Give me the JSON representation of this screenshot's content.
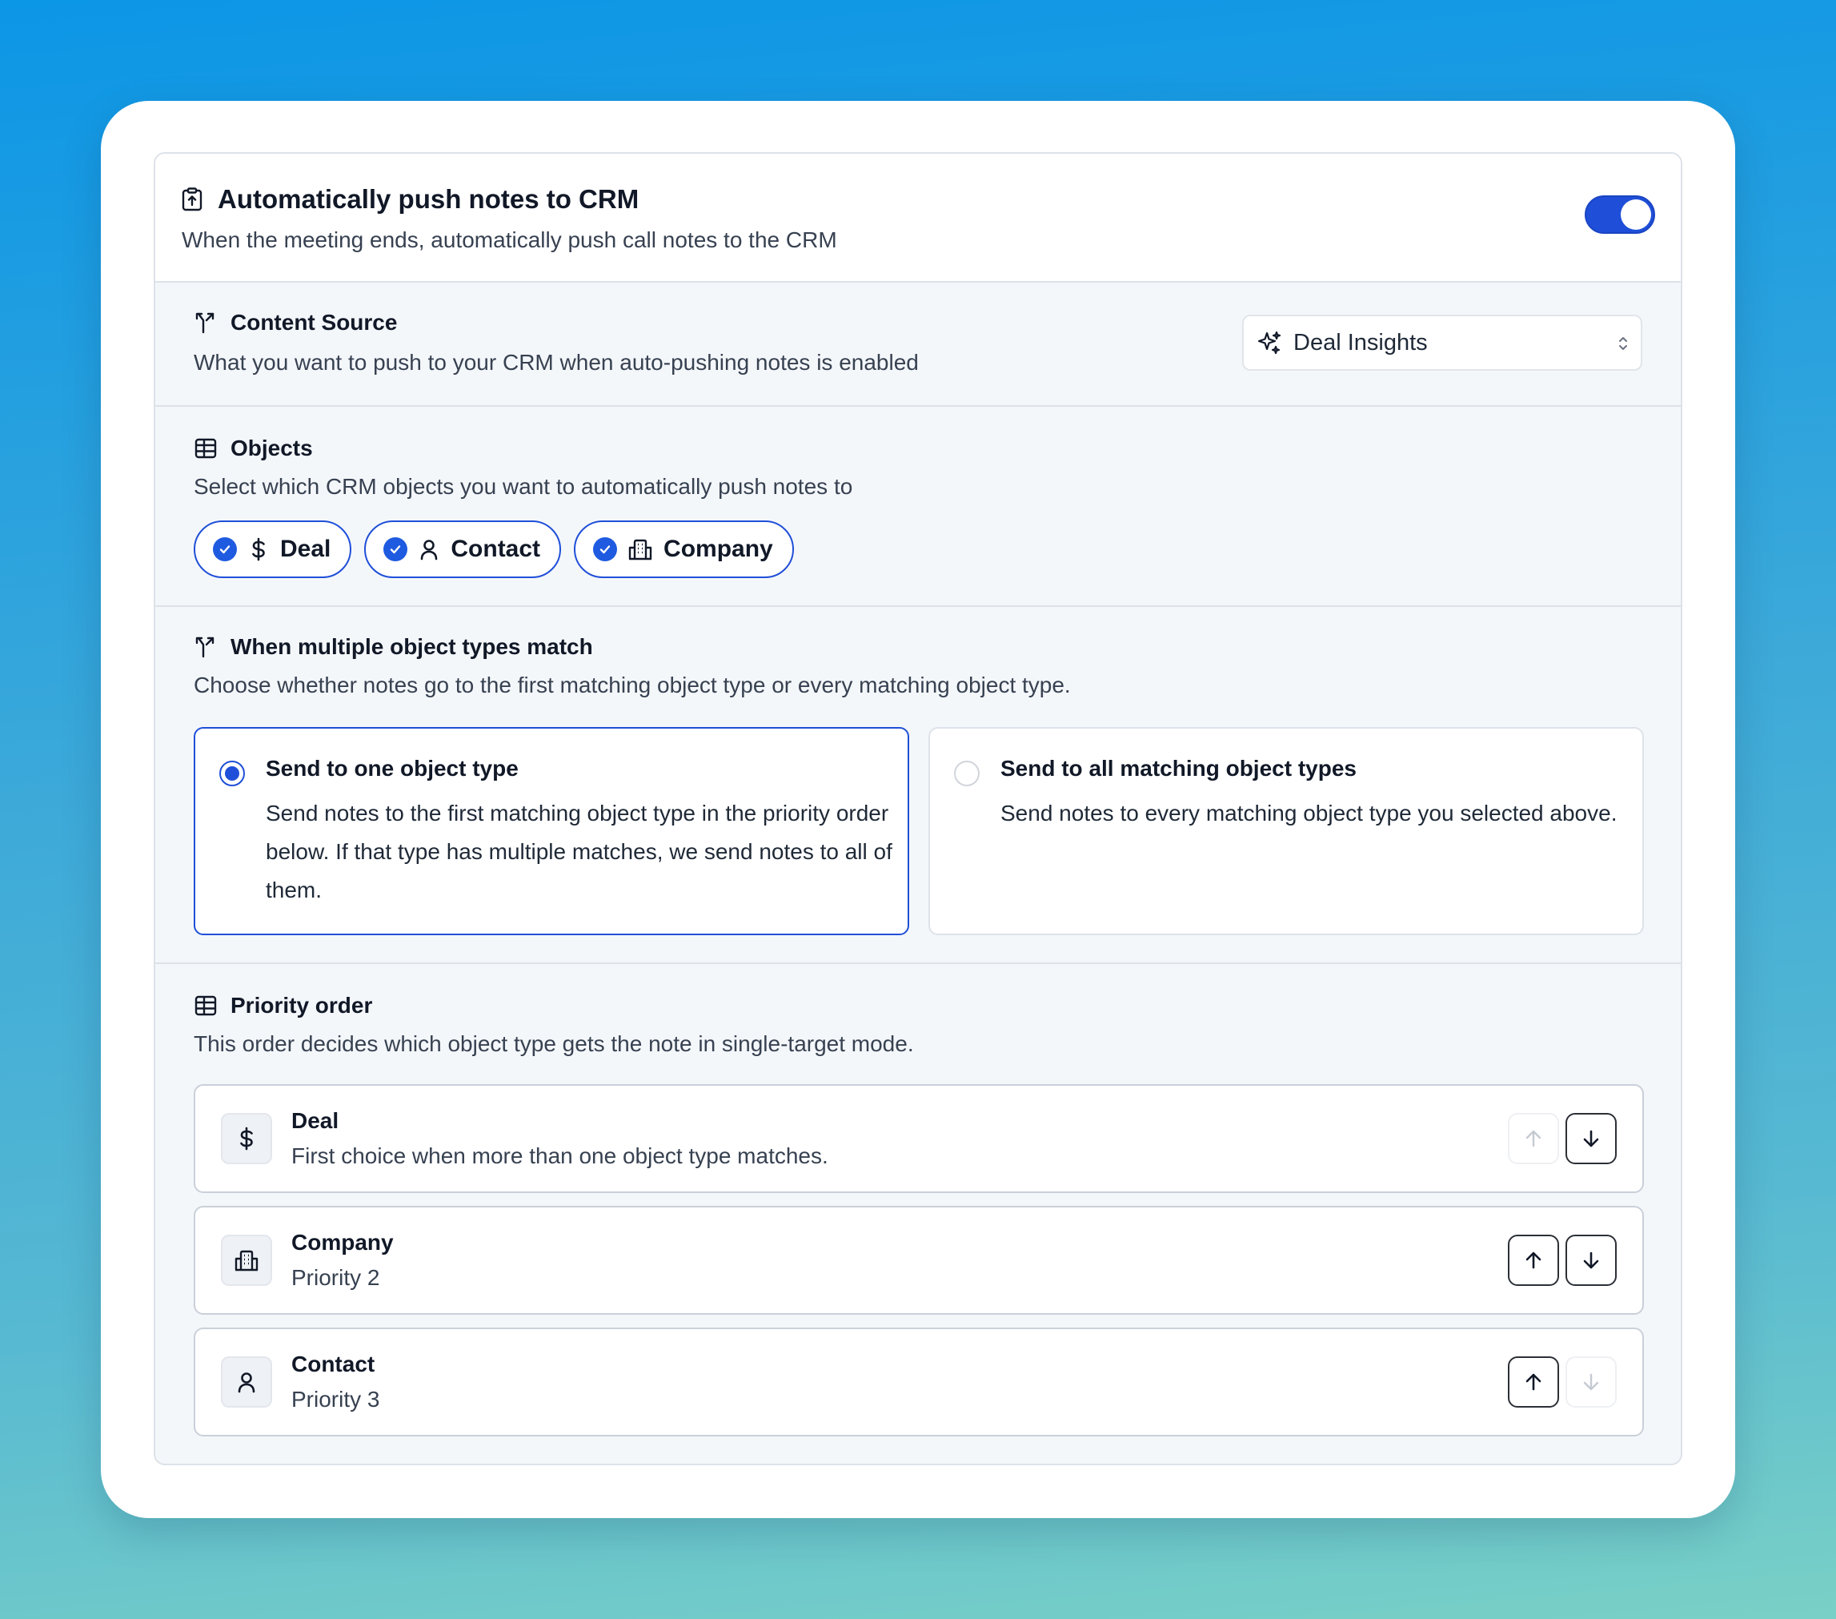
{
  "header": {
    "title": "Automatically push notes to CRM",
    "description": "When the meeting ends, automatically push call notes to the CRM",
    "toggle_on": true
  },
  "content_source": {
    "title": "Content Source",
    "description": "What you want to push to your CRM when auto-pushing notes is enabled",
    "selected": "Deal Insights"
  },
  "objects": {
    "title": "Objects",
    "description": "Select which CRM objects you want to automatically push notes to",
    "chips": [
      {
        "label": "Deal",
        "icon": "dollar-icon",
        "checked": true
      },
      {
        "label": "Contact",
        "icon": "user-icon",
        "checked": true
      },
      {
        "label": "Company",
        "icon": "building-icon",
        "checked": true
      }
    ]
  },
  "multiple_match": {
    "title": "When multiple object types match",
    "description": "Choose whether notes go to the first matching object type or every matching object type.",
    "options": [
      {
        "title": "Send to one object type",
        "description": "Send notes to the first matching object type in the priority order below. If that type has multiple matches, we send notes to all of them.",
        "selected": true
      },
      {
        "title": "Send to all matching object types",
        "description": "Send notes to every matching object type you selected above.",
        "selected": false
      }
    ]
  },
  "priority": {
    "title": "Priority order",
    "description": "This order decides which object type gets the note in single-target mode.",
    "rows": [
      {
        "name": "Deal",
        "description": "First choice when more than one object type matches.",
        "icon": "dollar-icon",
        "up_enabled": false,
        "down_enabled": true
      },
      {
        "name": "Company",
        "description": "Priority 2",
        "icon": "building-icon",
        "up_enabled": true,
        "down_enabled": true
      },
      {
        "name": "Contact",
        "description": "Priority 3",
        "icon": "user-icon",
        "up_enabled": true,
        "down_enabled": false
      }
    ]
  },
  "colors": {
    "accent": "#1f4fd8",
    "background_top": "#0c96e6",
    "background_bottom": "#79d0c6"
  }
}
